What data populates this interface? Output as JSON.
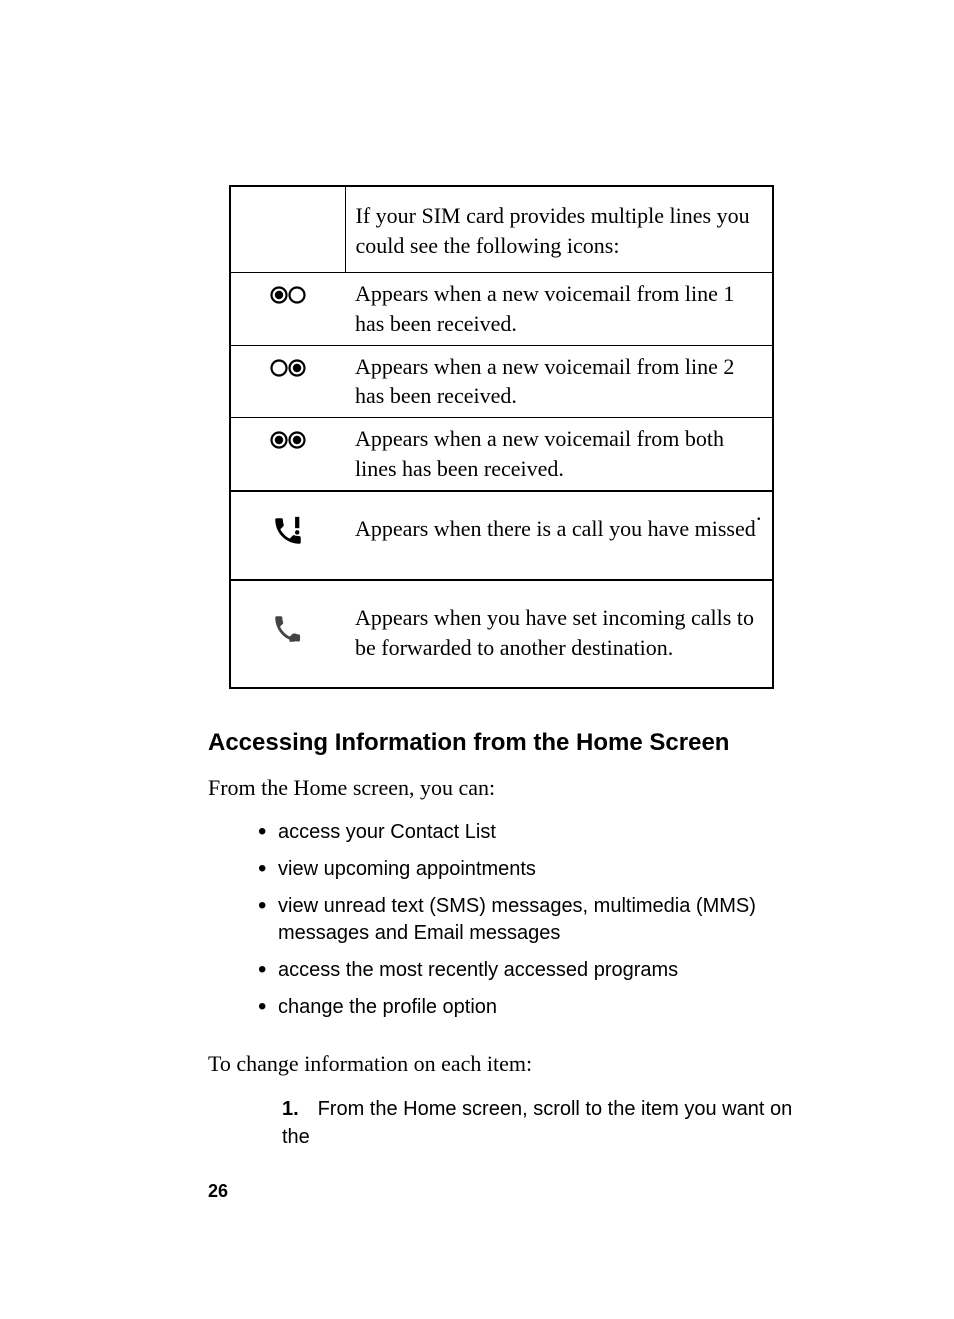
{
  "table": {
    "intro": "If your SIM card provides multiple lines you could see the following icons:",
    "row1": "Appears when a new voicemail from line 1 has been received.",
    "row2": "Appears when a new voicemail from line 2 has been received.",
    "row3": "Appears when a new voicemail from both lines has been received.",
    "missed": "Appears when there is a call you have missed",
    "forward": "Appears when you have set incoming calls to be forwarded to another destination."
  },
  "heading": "Accessing Information from the Home Screen",
  "intro_para": "From the Home screen, you can:",
  "bullets": [
    "access your Contact List",
    "view upcoming appointments",
    "view unread text (SMS) messages, multimedia (MMS) messages and Email messages",
    "access the most recently accessed programs",
    "change the profile option"
  ],
  "tochange": "To change information on each item:",
  "step1_num": "1.",
  "step1_text": "From the Home screen, scroll to the item you want on the",
  "page_number": "26"
}
